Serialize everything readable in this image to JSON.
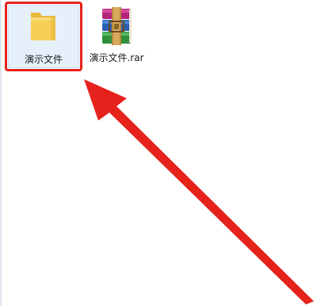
{
  "desktop": {
    "items": [
      {
        "label": "演示文件",
        "icon": "folder-icon",
        "selected": true
      },
      {
        "label": "演示文件.rar",
        "icon": "winrar-archive-icon",
        "selected": false
      }
    ]
  },
  "annotation": {
    "color": "#e5221b",
    "shapes": [
      "highlight-box",
      "pointer-arrow"
    ]
  }
}
